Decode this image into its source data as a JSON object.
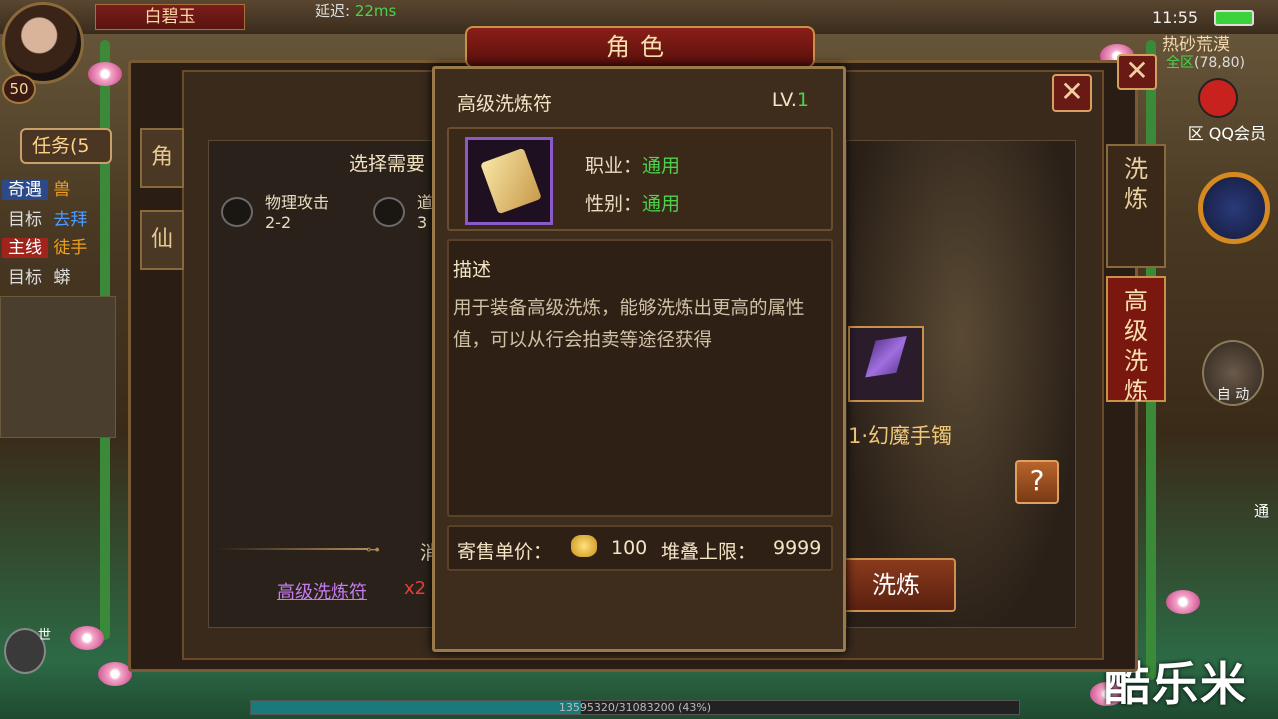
{
  "hud": {
    "player_name": "白碧玉",
    "level": "50",
    "latency_label": "延迟:",
    "latency_value": "22ms",
    "time": "11:55",
    "zone_name": "热砂荒漠",
    "zone_prefix": "全区",
    "coords": "(78,80)",
    "qq_label": "区 QQ会员",
    "auto_label": "自 动",
    "side_char": "通",
    "mic_label": "世",
    "xp_text": "13595320/31083200 (43%)",
    "watermark": "酷乐米"
  },
  "quest": {
    "tab_label": "任务(5",
    "rows": [
      {
        "tag": "奇遇",
        "text": "兽"
      },
      {
        "tag": "目标",
        "text": "去拜"
      },
      {
        "tag": "主线",
        "text": "徒手"
      },
      {
        "tag": "目标",
        "text": "蟒"
      }
    ]
  },
  "window": {
    "title": "角色",
    "close_icon": "✕",
    "left_tabs": [
      "角",
      "仙"
    ],
    "right_tabs": [
      {
        "label": "洗\n炼",
        "active": false
      },
      {
        "label": "高\n级\n洗\n炼",
        "active": true
      }
    ]
  },
  "refine_panel": {
    "select_title": "选择需要",
    "slots": [
      {
        "name": "物理攻击",
        "value": "2-2"
      },
      {
        "name": "道",
        "value": "3"
      }
    ],
    "divider_text": "消",
    "material_link": "高级洗炼符",
    "material_count": "x2",
    "item_name": "1·幻魔手镯",
    "help_label": "?",
    "refine_button": "洗炼"
  },
  "tooltip": {
    "name": "高级洗炼符",
    "level_prefix": "LV.",
    "level_value": "1",
    "class_label": "职业：",
    "class_value": "通用",
    "gender_label": "性别：",
    "gender_value": "通用",
    "desc_heading": "描述",
    "desc_text": "用于装备高级洗炼，能够洗炼出更高的属性值，可以从行会拍卖等途径获得",
    "price_label": "寄售单价：",
    "price_value": "100",
    "stack_label": "堆叠上限：",
    "stack_value": "9999",
    "close_icon": "✕"
  },
  "colors": {
    "accent_green": "#4cd24c",
    "title_red": "#7a1810",
    "link_purple": "#c67cf0",
    "count_red": "#e0423a",
    "frame_gold": "#c9904a"
  }
}
